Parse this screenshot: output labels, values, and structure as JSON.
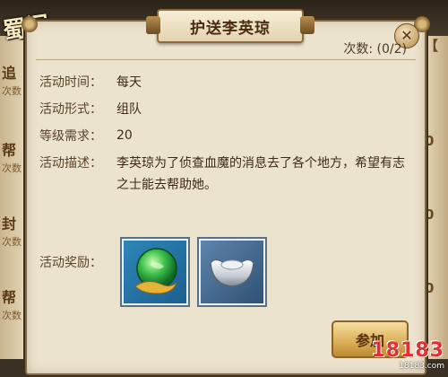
{
  "game": {
    "logo_text": "蜀门"
  },
  "side_menu": [
    {
      "label": "追",
      "sub": "次数"
    },
    {
      "label": "帮",
      "sub": "次数"
    },
    {
      "label": "封",
      "sub": "次数"
    },
    {
      "label": "帮",
      "sub": "次数"
    }
  ],
  "right_menu": [
    "【",
    "0",
    "0",
    "0"
  ],
  "dialog": {
    "title": "护送李英琼",
    "close_icon": "close-icon",
    "count": "次数: (0/2)",
    "rows": [
      {
        "label": "活动时间：",
        "value": "每天"
      },
      {
        "label": "活动形式：",
        "value": "组队"
      },
      {
        "label": "等级需求：",
        "value": "20"
      }
    ],
    "desc_label": "活动描述：",
    "desc_value": "李英琼为了侦查血魔的消息去了各个地方，希望有志之士能去帮助她。",
    "reward_label": "活动奖励：",
    "rewards": [
      {
        "name": "green-orb-item-icon"
      },
      {
        "name": "silver-ingot-item-icon"
      }
    ],
    "join_label": "参加"
  },
  "watermark": {
    "main": "18183",
    "sub": "18183.com"
  },
  "colors": {
    "panel": "#ece3cf",
    "border": "#7d6444",
    "button": "#d9ad55"
  }
}
